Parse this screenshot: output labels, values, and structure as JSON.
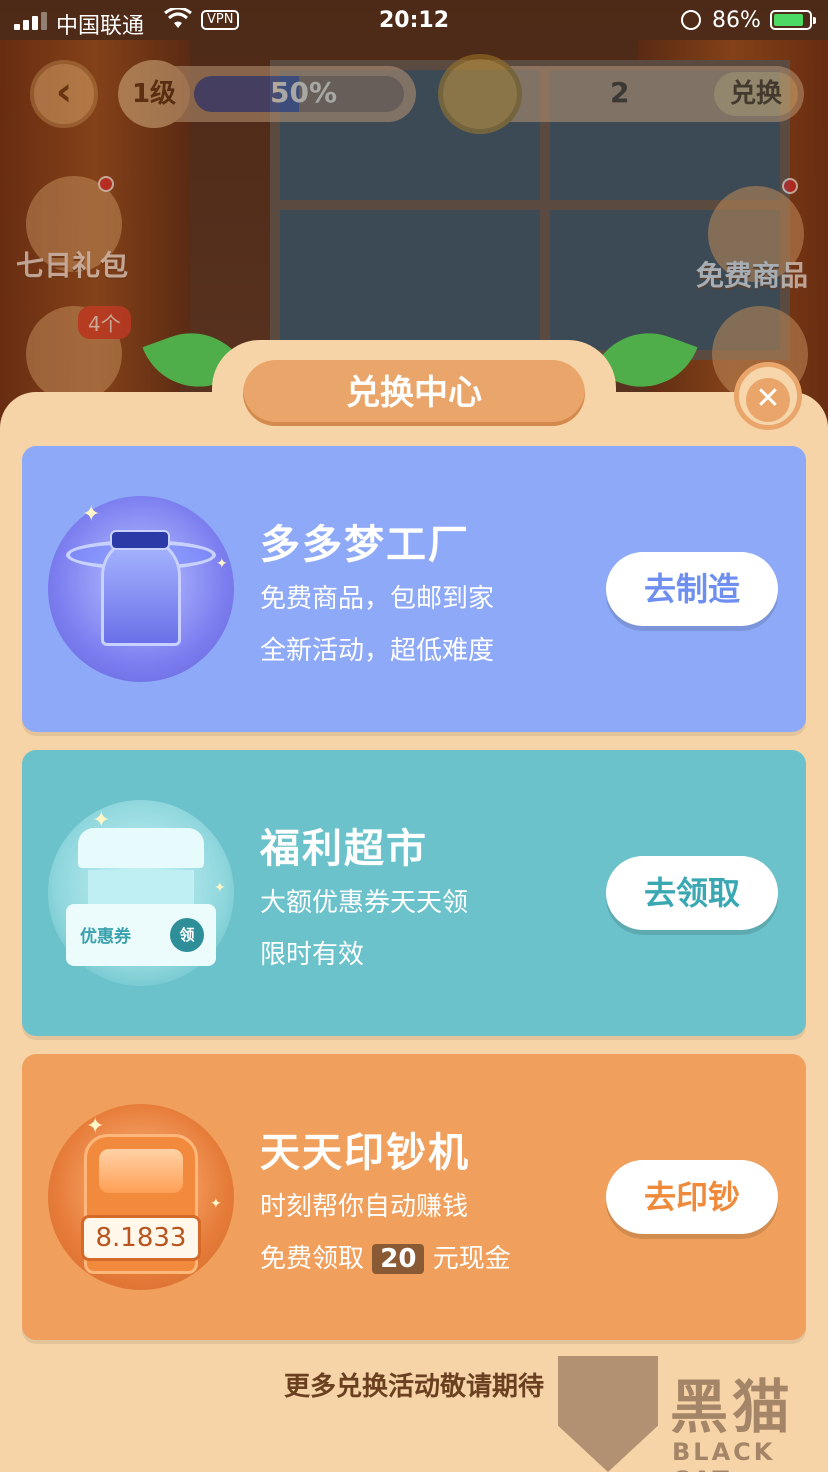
{
  "status_bar": {
    "carrier": "中国联通",
    "vpn": "VPN",
    "time": "20:12",
    "battery_pct": "86%",
    "battery_level": 0.86
  },
  "hud": {
    "back_icon": "chevron-left-icon",
    "level": "1级",
    "level_progress": "50%",
    "level_progress_value": 0.5,
    "coin_count": "2",
    "redeem_label": "兑换",
    "side_left_1": "七日礼包",
    "side_left_2_badge": "4个",
    "side_right_1": "免费商品"
  },
  "modal": {
    "title": "兑换中心",
    "close_icon": "close-icon",
    "footer": "更多兑换活动敬请期待"
  },
  "cards": [
    {
      "title": "多多梦工厂",
      "line1": "免费商品，包邮到家",
      "line2": "全新活动，超低难度",
      "button": "去制造",
      "color": "#8ea9f7"
    },
    {
      "title": "福利超市",
      "line1": "大额优惠券天天领",
      "line2": "限时有效",
      "button": "去领取",
      "ticket_text": "优惠券",
      "ticket_button": "领",
      "color": "#6bc2ca"
    },
    {
      "title": "天天印钞机",
      "line1": "时刻帮你自动赚钱",
      "line2_prefix": "免费领取",
      "line2_amount": "20",
      "line2_suffix": "元现金",
      "button": "去印钞",
      "machine_value": "8.1833",
      "color": "#f0a05c"
    }
  ],
  "watermark": {
    "cn": "黑猫",
    "en": "BLACK CAT"
  }
}
